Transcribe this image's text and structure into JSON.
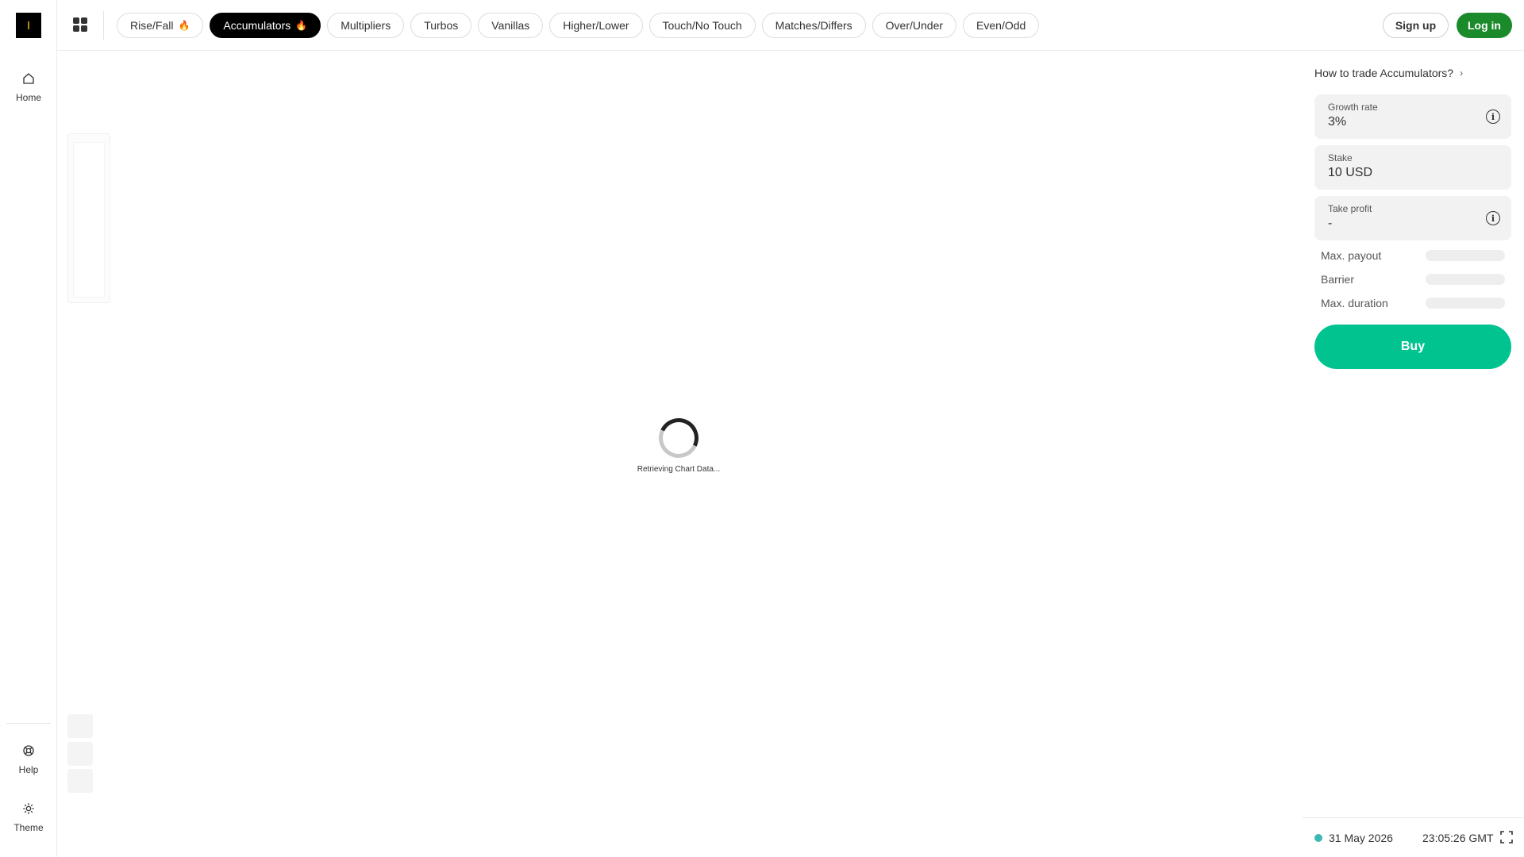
{
  "sidebar": {
    "home_label": "Home",
    "help_label": "Help",
    "theme_label": "Theme"
  },
  "topbar": {
    "tabs": [
      {
        "label": "Rise/Fall",
        "hot": true
      },
      {
        "label": "Accumulators",
        "hot": true,
        "active": true
      },
      {
        "label": "Multipliers"
      },
      {
        "label": "Turbos"
      },
      {
        "label": "Vanillas"
      },
      {
        "label": "Higher/Lower"
      },
      {
        "label": "Touch/No Touch"
      },
      {
        "label": "Matches/Differs"
      },
      {
        "label": "Over/Under"
      },
      {
        "label": "Even/Odd"
      }
    ],
    "fire_icon": "🔥",
    "signup_label": "Sign up",
    "login_label": "Log in"
  },
  "chart": {
    "loading_text": "Retrieving Chart Data..."
  },
  "panel": {
    "how_to_label": "How to trade Accumulators?",
    "growth_rate": {
      "label": "Growth rate",
      "value": "3%"
    },
    "stake": {
      "label": "Stake",
      "value": "10 USD"
    },
    "take_profit": {
      "label": "Take profit",
      "value": "-"
    },
    "max_payout_label": "Max. payout",
    "barrier_label": "Barrier",
    "max_duration_label": "Max. duration",
    "buy_label": "Buy"
  },
  "footer": {
    "date": "31 May 2026",
    "time": "23:05:26 GMT"
  },
  "colors": {
    "buy": "#00c390",
    "login": "#1a8a2a",
    "status_dot": "#3cb9b3"
  }
}
